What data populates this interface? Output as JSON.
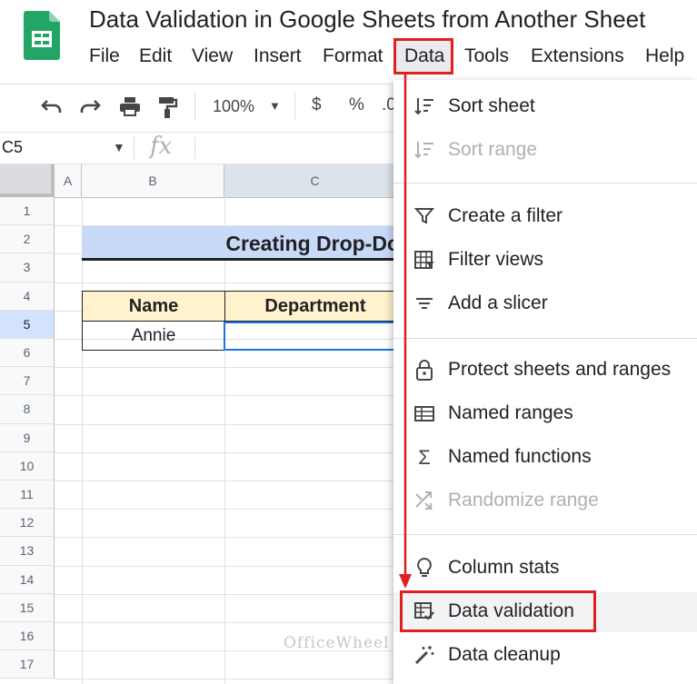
{
  "app": {
    "title": "Data Validation in Google Sheets from Another Sheet",
    "menu": [
      "File",
      "Edit",
      "View",
      "Insert",
      "Format",
      "Data",
      "Tools",
      "Extensions",
      "Help"
    ]
  },
  "toolbar": {
    "zoom": "100%",
    "currency_symbol": "$",
    "percent_symbol": "%",
    "decimal_symbol": ".0"
  },
  "formula_bar": {
    "cell_ref": "C5",
    "fx_label": "fx"
  },
  "sheet": {
    "columns": [
      "A",
      "B",
      "C"
    ],
    "rows": [
      "1",
      "2",
      "3",
      "4",
      "5",
      "6",
      "7",
      "8",
      "9",
      "10",
      "11",
      "12",
      "13",
      "14",
      "15",
      "16",
      "17"
    ],
    "active_row": "5",
    "title_text": "Creating Drop-Do",
    "table": {
      "headers": [
        "Name",
        "Department"
      ],
      "row": [
        "Annie",
        ""
      ]
    }
  },
  "data_menu": {
    "items": [
      {
        "label": "Sort sheet",
        "icon": "sort-icon",
        "enabled": true
      },
      {
        "label": "Sort range",
        "icon": "sort-icon",
        "enabled": false
      },
      {
        "label": "Create a filter",
        "icon": "filter-icon",
        "enabled": true
      },
      {
        "label": "Filter views",
        "icon": "filter-views-icon",
        "enabled": true
      },
      {
        "label": "Add a slicer",
        "icon": "slicer-icon",
        "enabled": true
      },
      {
        "label": "Protect sheets and ranges",
        "icon": "lock-icon",
        "enabled": true
      },
      {
        "label": "Named ranges",
        "icon": "named-ranges-icon",
        "enabled": true
      },
      {
        "label": "Named functions",
        "icon": "sigma-icon",
        "enabled": true
      },
      {
        "label": "Randomize range",
        "icon": "shuffle-icon",
        "enabled": false
      },
      {
        "label": "Column stats",
        "icon": "lightbulb-icon",
        "enabled": true
      },
      {
        "label": "Data validation",
        "icon": "data-validation-icon",
        "enabled": true
      },
      {
        "label": "Data cleanup",
        "icon": "magic-wand-icon",
        "enabled": true
      }
    ]
  },
  "watermark": "OfficeWheel",
  "colors": {
    "highlight_red": "#e02020",
    "title_fill": "#c9daf8",
    "header_fill": "#fff2cc",
    "selection_blue": "#1a73e8",
    "sheets_green": "#23a566"
  }
}
